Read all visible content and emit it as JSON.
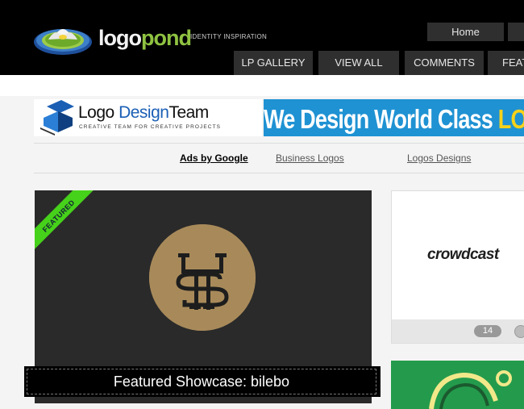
{
  "header": {
    "brand_left": "logo",
    "brand_right": "pond",
    "tagline": "IDENTITY INSPIRATION",
    "home_label": "Home",
    "nav": [
      "LP GALLERY",
      "VIEW ALL",
      "COMMENTS",
      "FEAT"
    ]
  },
  "banner": {
    "title_logo": "Logo ",
    "title_design": "Design",
    "title_team": "Team",
    "subtitle": "CREATIVE TEAM FOR CREATIVE PROJECTS",
    "headline": "We Design World Class ",
    "headline_accent": "LOGO"
  },
  "ads": {
    "label": "Ads by Google",
    "links": [
      "Business Logos",
      "Logos Designs"
    ]
  },
  "featured": {
    "ribbon": "FEATURED",
    "caption": "Featured Showcase: bilebo"
  },
  "cards": [
    {
      "logo_text": "crowdcast",
      "count": "14"
    }
  ],
  "colors": {
    "header_bg": "#000000",
    "nav_bg": "#2f2f2f",
    "brand_green": "#8fc241",
    "banner_blue": "#1f92d3",
    "banner_yellow": "#f7d21a",
    "ribbon_green": "#46d11a",
    "emblem_gold": "#a88a5a"
  }
}
